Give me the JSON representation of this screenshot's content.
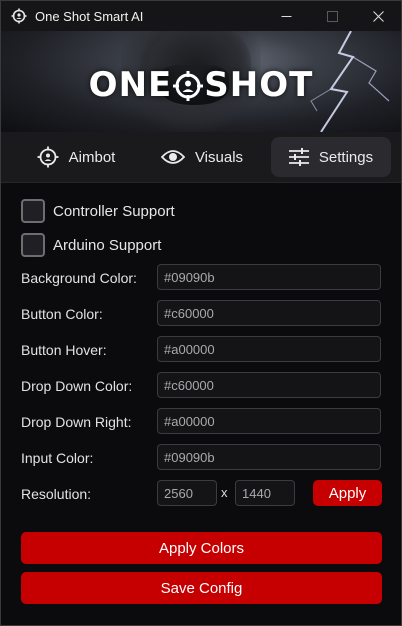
{
  "window": {
    "title": "One Shot Smart AI",
    "icons": {
      "app": "crosshair-icon",
      "minimize": "minimize-icon",
      "maximize": "maximize-icon",
      "close": "close-icon"
    }
  },
  "banner": {
    "logo_left": "ONE",
    "logo_right": "SHOT"
  },
  "tabs": [
    {
      "label": "Aimbot",
      "icon": "crosshair-icon",
      "active": false
    },
    {
      "label": "Visuals",
      "icon": "eye-icon",
      "active": false
    },
    {
      "label": "Settings",
      "icon": "sliders-icon",
      "active": true
    }
  ],
  "settings": {
    "controller_support": {
      "label": "Controller Support",
      "checked": false
    },
    "arduino_support": {
      "label": "Arduino Support",
      "checked": false
    },
    "fields": [
      {
        "label": "Background Color:",
        "value": "#09090b"
      },
      {
        "label": "Button Color:",
        "value": "#c60000"
      },
      {
        "label": "Button Hover:",
        "value": "#a00000"
      },
      {
        "label": "Drop Down Color:",
        "value": "#c60000"
      },
      {
        "label": "Drop Down Right:",
        "value": "#a00000"
      },
      {
        "label": "Input Color:",
        "value": "#09090b"
      }
    ],
    "resolution": {
      "label": "Resolution:",
      "width": "2560",
      "separator": "x",
      "height": "1440",
      "apply_label": "Apply"
    }
  },
  "actions": {
    "apply_colors": "Apply Colors",
    "save_config": "Save Config"
  },
  "colors": {
    "accent": "#c60000",
    "background": "#09090b",
    "tab_active": "#2b2b2f"
  }
}
